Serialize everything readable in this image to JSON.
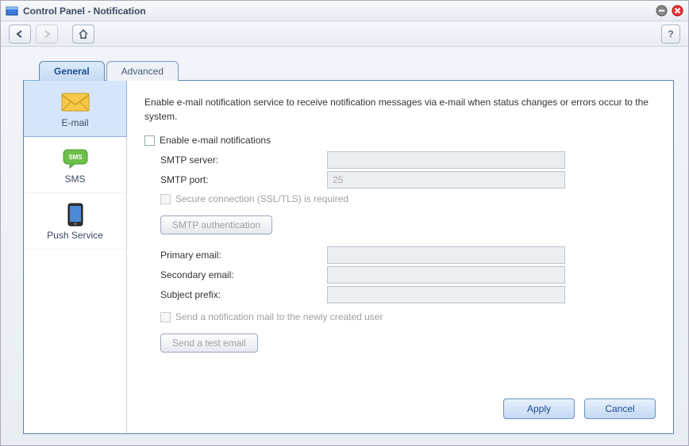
{
  "window": {
    "title": "Control Panel - Notification"
  },
  "tabs": {
    "general": "General",
    "advanced": "Advanced"
  },
  "sidebar": {
    "email": "E-mail",
    "sms": "SMS",
    "push": "Push Service"
  },
  "main": {
    "description": "Enable e-mail notification service to receive notification messages via e-mail when status changes or errors occur to the system.",
    "enable_label": "Enable e-mail notifications",
    "smtp_server_label": "SMTP server:",
    "smtp_server_value": "",
    "smtp_port_label": "SMTP port:",
    "smtp_port_value": "25",
    "ssl_label": "Secure connection (SSL/TLS) is required",
    "smtp_auth_button": "SMTP authentication",
    "primary_email_label": "Primary email:",
    "primary_email_value": "",
    "secondary_email_label": "Secondary email:",
    "secondary_email_value": "",
    "subject_prefix_label": "Subject prefix:",
    "subject_prefix_value": "",
    "send_newuser_label": "Send a notification mail to the newly created user",
    "send_test_button": "Send a test email"
  },
  "footer": {
    "apply": "Apply",
    "cancel": "Cancel"
  }
}
